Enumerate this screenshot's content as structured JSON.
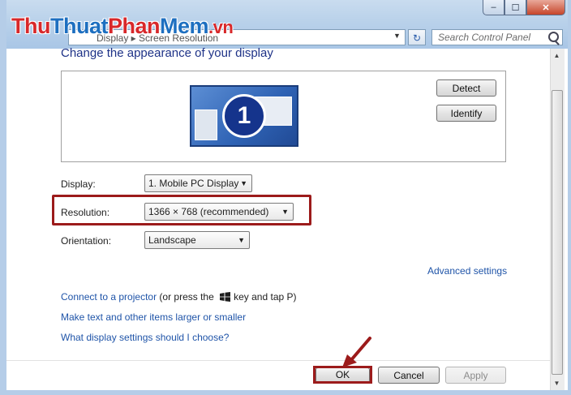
{
  "window": {
    "minimize_glyph": "‒",
    "maximize_glyph": "☐",
    "close_glyph": "✕"
  },
  "watermark": {
    "part1": "Thu",
    "part2": "Thuat",
    "part3": "Phan",
    "part4": "Mem",
    "part5": ".vn"
  },
  "address": {
    "breadcrumb": "Display ▸ Screen Resolution",
    "refresh_glyph": "↻"
  },
  "search": {
    "placeholder": "Search Control Panel"
  },
  "content": {
    "heading": "Change the appearance of your display",
    "monitor_number": "1",
    "detect_label": "Detect",
    "identify_label": "Identify",
    "display_label": "Display:",
    "display_value": "1. Mobile PC Display",
    "resolution_label": "Resolution:",
    "resolution_value": "1366 × 768 (recommended)",
    "orientation_label": "Orientation:",
    "orientation_value": "Landscape",
    "advanced_link": "Advanced settings",
    "projector_link": "Connect to a projector",
    "projector_suffix_before": "(or press the",
    "projector_suffix_after": "key and tap P)",
    "text_size_link": "Make text and other items larger or smaller",
    "help_link": "What display settings should I choose?"
  },
  "footer": {
    "ok_label": "OK",
    "cancel_label": "Cancel",
    "apply_label": "Apply"
  },
  "colors": {
    "link": "#1f54a8",
    "highlight_border": "#9c1b1b",
    "heading": "#1e3287"
  }
}
